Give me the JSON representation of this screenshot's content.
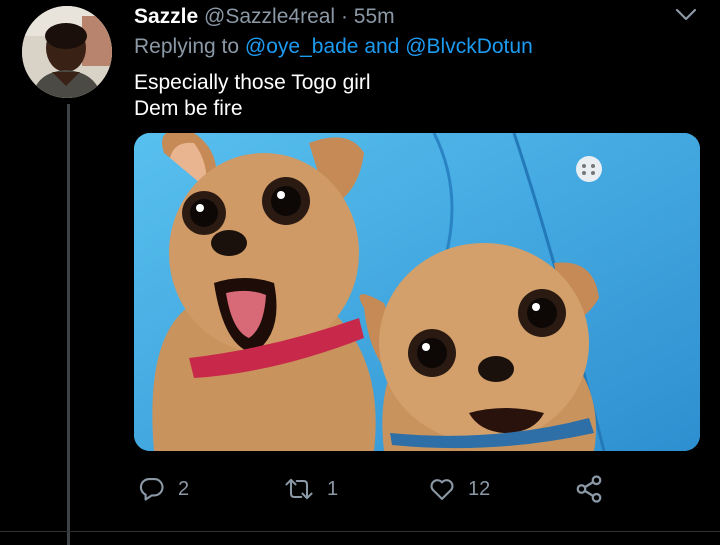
{
  "tweet": {
    "display_name": "Sazzle",
    "handle": "@Sazzle4real",
    "separator": "·",
    "time": "55m",
    "replying_prefix": "Replying to",
    "mention_1": "@oye_bade",
    "mention_joiner": "and",
    "mention_2": "@BlvckDotun",
    "text_line_1": "Especially those Togo girl",
    "text_line_2": "Dem be fire"
  },
  "actions": {
    "replies": "2",
    "retweets": "1",
    "likes": "12"
  },
  "icons": {
    "reply": "reply-icon",
    "retweet": "retweet-icon",
    "like": "heart-icon",
    "share": "share-icon",
    "menu": "chevron-down-icon"
  },
  "colors": {
    "background": "#000000",
    "secondary_text": "#8b98a5",
    "mention": "#1d9bf0",
    "thread_line": "#3d4247"
  }
}
